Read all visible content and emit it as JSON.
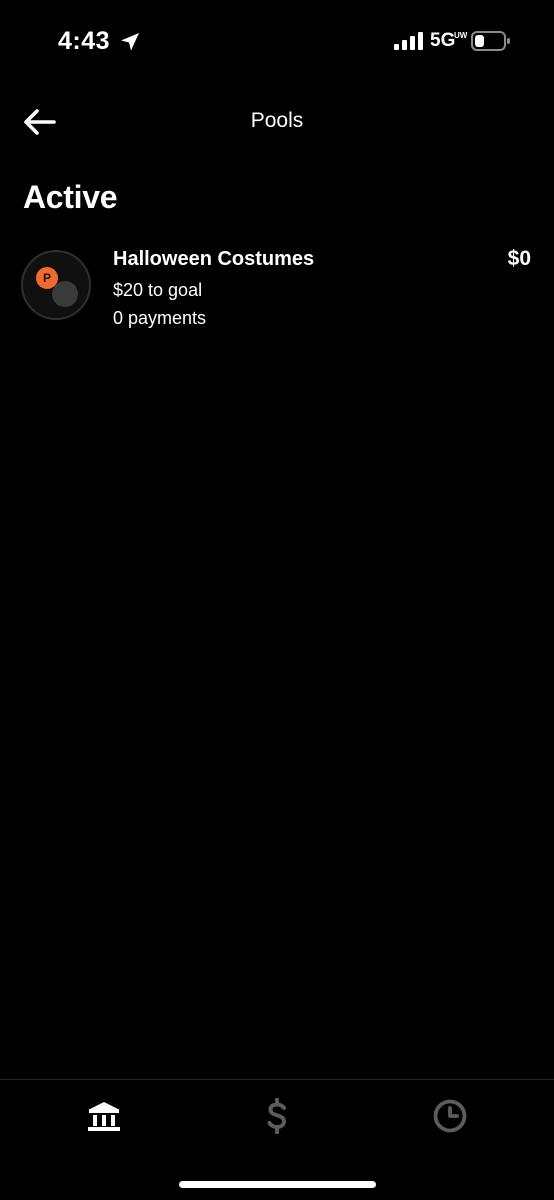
{
  "status_bar": {
    "time": "4:43",
    "network": "5G",
    "network_sub": "UW"
  },
  "header": {
    "title": "Pools"
  },
  "sections": [
    {
      "heading": "Active",
      "pools": [
        {
          "avatar_initial": "P",
          "name": "Halloween Costumes",
          "amount": "$0",
          "goal_text": "$20 to goal",
          "payments_text": "0 payments"
        }
      ]
    }
  ],
  "tabs": [
    {
      "icon": "bank-icon",
      "active": true
    },
    {
      "icon": "dollar-icon",
      "active": false
    },
    {
      "icon": "clock-icon",
      "active": false
    }
  ],
  "colors": {
    "background": "#000000",
    "text": "#ffffff",
    "accent_orange": "#f26a30",
    "inactive_tab": "#5c5c5c",
    "divider": "#262626"
  }
}
